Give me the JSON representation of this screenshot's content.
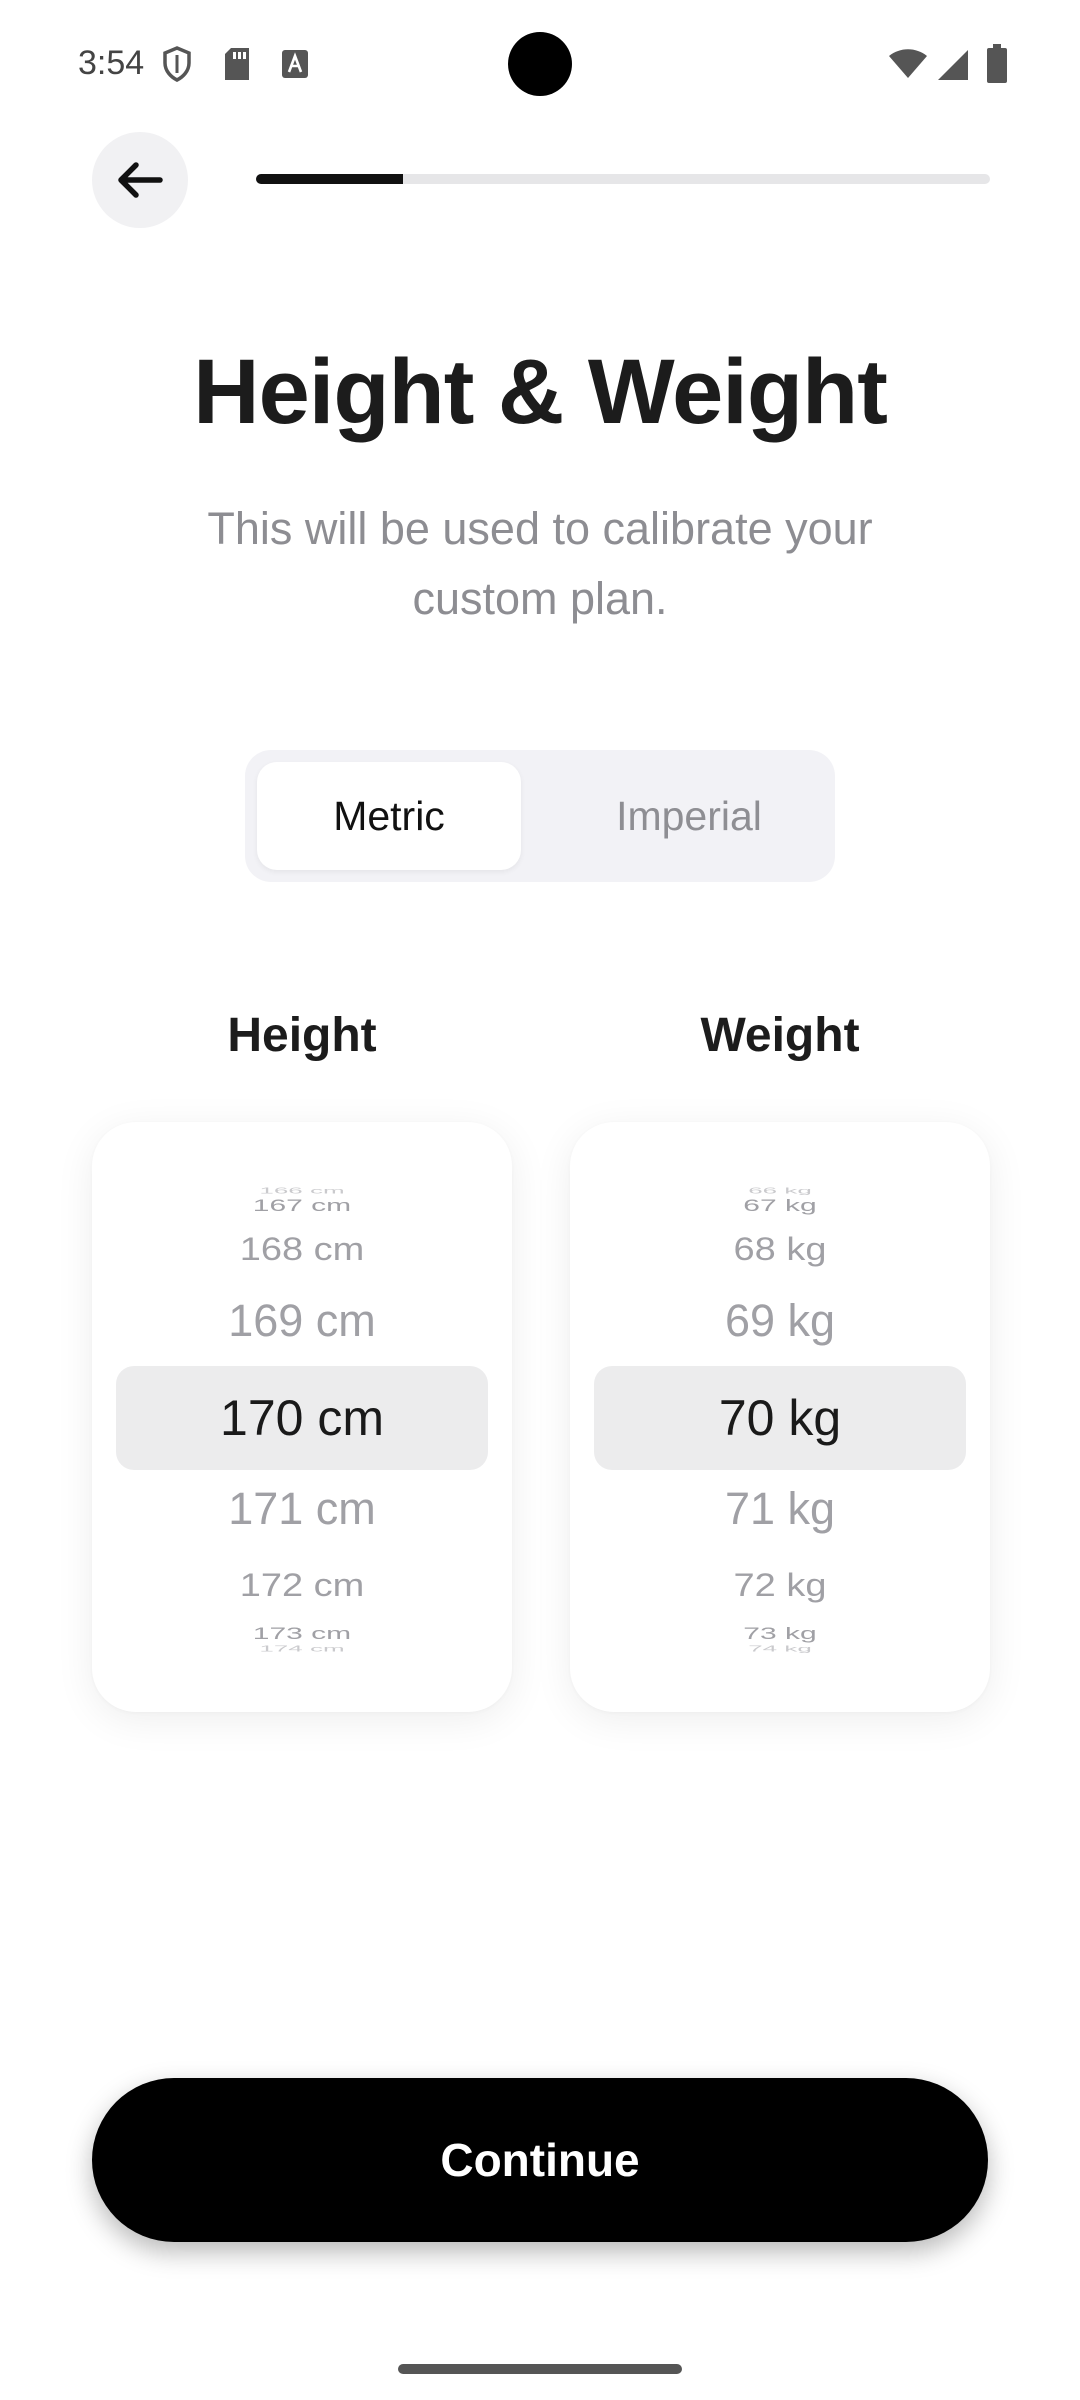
{
  "status_bar": {
    "time": "3:54",
    "icons": [
      "shield-icon",
      "sd-card-icon",
      "text-a-icon",
      "wifi-icon",
      "signal-icon",
      "battery-icon"
    ]
  },
  "nav": {
    "back_icon": "arrow-left-icon",
    "progress": 0.2
  },
  "header": {
    "title": "Height & Weight",
    "subtitle": "This will be used to calibrate your custom plan."
  },
  "unit_toggle": {
    "options": [
      "Metric",
      "Imperial"
    ],
    "selected": "Metric"
  },
  "height": {
    "label": "Height",
    "items": [
      "166 cm",
      "167 cm",
      "168 cm",
      "169 cm",
      "170 cm",
      "171 cm",
      "172 cm",
      "173 cm",
      "174 cm"
    ],
    "selected": "170 cm"
  },
  "weight": {
    "label": "Weight",
    "items": [
      "66 kg",
      "67 kg",
      "68 kg",
      "69 kg",
      "70 kg",
      "71 kg",
      "72 kg",
      "73 kg",
      "74 kg"
    ],
    "selected": "70 kg"
  },
  "footer": {
    "continue_label": "Continue"
  },
  "colors": {
    "primary": "#000000",
    "background": "#ffffff",
    "muted_text": "#8d8d92",
    "picker_highlight": "#ececed"
  }
}
